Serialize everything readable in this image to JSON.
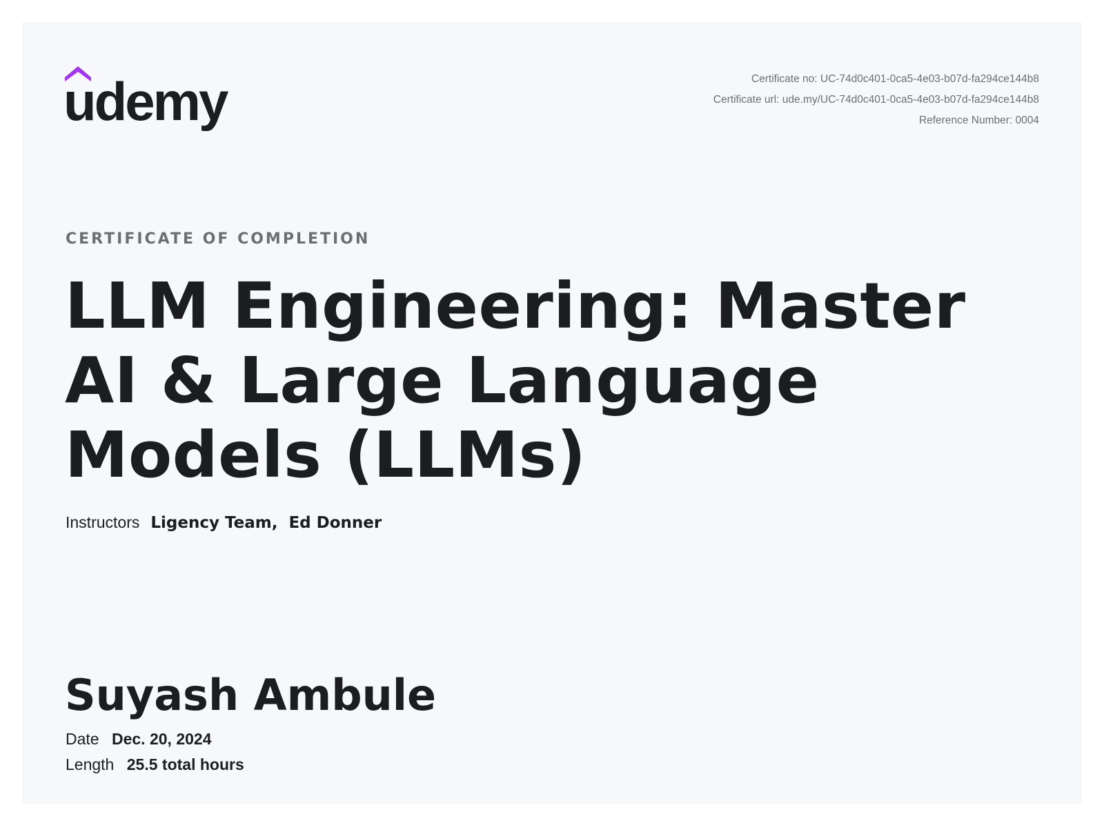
{
  "brand": {
    "logo_text": "udemy",
    "accent_color": "#a435f0",
    "ink_color": "#1c1d1f"
  },
  "certificate": {
    "number_label": "Certificate no:",
    "number": "UC-74d0c401-0ca5-4e03-b07d-fa294ce144b8",
    "url_label": "Certificate url:",
    "url": "ude.my/UC-74d0c401-0ca5-4e03-b07d-fa294ce144b8",
    "reference_label": "Reference Number:",
    "reference": "0004",
    "eyebrow": "CERTIFICATE OF COMPLETION"
  },
  "course": {
    "title": "LLM Engineering: Master AI & Large Language Models (LLMs)",
    "instructors_label": "Instructors",
    "instructors": [
      "Ligency Team,",
      "Ed Donner"
    ]
  },
  "student": {
    "name": "Suyash Ambule"
  },
  "details": {
    "date_label": "Date",
    "date": "Dec. 20, 2024",
    "length_label": "Length",
    "length": "25.5 total hours"
  }
}
